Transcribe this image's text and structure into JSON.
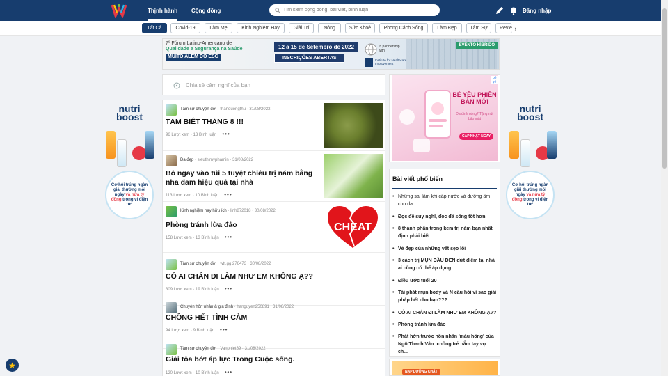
{
  "header": {
    "tabs": [
      {
        "label": "Thịnh hành",
        "active": true
      },
      {
        "label": "Cộng đồng",
        "active": false
      }
    ],
    "search_placeholder": "Tìm kiếm cộng đồng, bài viết, bình luận",
    "login_label": "Đăng nhập",
    "icons": [
      "pencil-icon",
      "bell-icon"
    ]
  },
  "categories": [
    "Tất Cả",
    "Covid-19",
    "Làm Mẹ",
    "Kinh Nghiệm Hay",
    "Giải Trí",
    "Nóng",
    "Sức Khoẻ",
    "Phong Cách Sống",
    "Làm Đẹp",
    "Tâm Sự",
    "Review"
  ],
  "active_category": "Tất Cả",
  "banner": {
    "line1": "7º Fórum Latino-Americano de",
    "line2": "Qualidade e Segurança na Saúde",
    "line3": "MUITO ALÉM DO ESG",
    "dates": "12 a 15 de Setembro de 2022",
    "cta": "INSCRIÇÕES ABERTAS",
    "partner": "In partnership with",
    "institute": "Institute for Healthcare Improvement",
    "event_tag": "EVENTO HÍBRIDO"
  },
  "composer": {
    "placeholder": "Chia sẻ cảm nghĩ của bạn"
  },
  "posts": [
    {
      "category": "Tâm sự chuyện đời",
      "author": "thanduongthu",
      "date": "31/08/2022",
      "title": "TẠM BIỆT THÁNG 8 !!!",
      "views": "96 Lượt xem",
      "comments": "13 Bình luận"
    },
    {
      "category": "Da đẹp",
      "author": "sieuthimyphamin",
      "date": "31/08/2022",
      "title": "Bỏ ngay vào túi 5 tuyệt chiêu trị nám bằng nha đam hiệu quả tại nhà",
      "views": "113 Lượt xem",
      "comments": "10 Bình luận"
    },
    {
      "category": "Kinh nghiệm hay hữu ích",
      "author": "linh872018",
      "date": "30/08/2022",
      "title": "Phòng tránh lừa đảo",
      "views": "158 Lượt xem",
      "comments": "13 Bình luận",
      "thumb_text": "CHEAT"
    },
    {
      "category": "Tâm sự chuyện đời",
      "author": "wtt.gg.276473",
      "date": "30/08/2022",
      "title": "CÓ AI CHÁN ĐI LÀM NHƯ EM KHÔNG Ạ??",
      "views": "309 Lượt xem",
      "comments": "19 Bình luận"
    },
    {
      "category": "Chuyện hôn nhân & gia đình",
      "author": "hanguyen250891",
      "date": "31/08/2022",
      "title": "CHỒNG HẾT TÌNH CẢM",
      "views": "94 Lượt xem",
      "comments": "9 Bình luận"
    },
    {
      "category": "Tâm sự chuyện đời",
      "author": "Vanphiet69",
      "date": "31/08/2022",
      "title": "Giải tỏa bớt áp lực Trong Cuộc sống.",
      "views": "120 Lượt xem",
      "comments": "10 Bình luận"
    }
  ],
  "side_ad": {
    "brand_top": "nutri",
    "brand_bottom": "boost",
    "bubble_line1": "Cơ hội trúng ngàn giải thưởng mỗi ngày",
    "bubble_line2": "và nửa tỷ đồng",
    "bubble_line3": "trong ví điện tử*"
  },
  "right_ad": {
    "title": "BÉ YÊU PHIÊN BẢN MỚI",
    "sub": "Da đinh nóng? Tặng nút bảo mật",
    "cta": "CẬP NHẬT NGAY",
    "ad_tag": "bé yê"
  },
  "popular": {
    "heading": "Bài viết phổ biến",
    "items": [
      {
        "text": "Những sai lầm khi cấp nước và dưỡng ẩm cho da",
        "bold": false
      },
      {
        "text": "Đọc để suy nghĩ, đọc để sống tốt hơn",
        "bold": true
      },
      {
        "text": "8 thành phần trong kem trị nám bạn nhất định phải biết",
        "bold": true
      },
      {
        "text": "Vẻ đẹp của những vết sẹo lồi",
        "bold": true
      },
      {
        "text": "3 cách trị MỤN ĐẦU ĐEN dứt điểm tại nhà ai cũng có thể áp dụng",
        "bold": true
      },
      {
        "text": "Điều ước tuổi 20",
        "bold": true
      },
      {
        "text": "Tái phát mụn body và N câu hỏi vì sao giải pháp hết cho bạn???",
        "bold": true
      },
      {
        "text": "CÓ AI CHÁN ĐI LÀM NHƯ EM KHÔNG Ạ??",
        "bold": true
      },
      {
        "text": "Phòng tránh lừa đảo",
        "bold": true
      },
      {
        "text": "Phát hờn trước hôn nhân 'màu hồng' của Ngô Thanh Vân: chồng trẻ nắm tay vợ ch...",
        "bold": true
      }
    ]
  },
  "right_ad2": {
    "tag": "NẠP DƯỠNG CHẤT"
  },
  "colors": {
    "nav": "#173d6e",
    "accent": "#2b9c6d",
    "danger": "#e63946"
  }
}
